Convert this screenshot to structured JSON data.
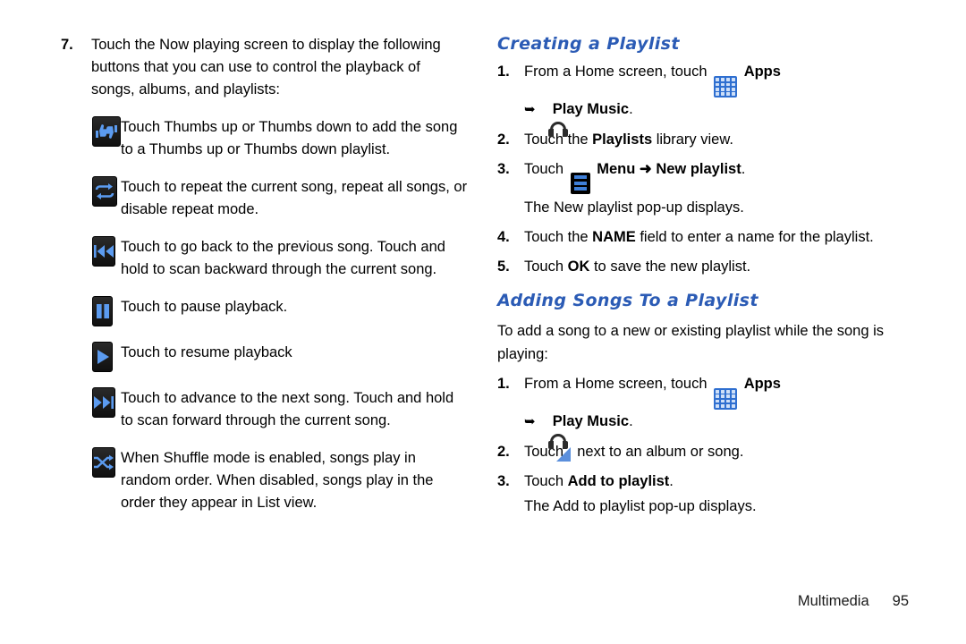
{
  "left_column": {
    "step": {
      "number": "7.",
      "text": "Touch the Now playing screen to display the following buttons that you can use to control the playback of songs, albums, and playlists:"
    },
    "controls": [
      {
        "icon": "thumbs-up-down-icon",
        "text": "Touch Thumbs up or Thumbs down to add the song to a Thumbs up or Thumbs down playlist."
      },
      {
        "icon": "repeat-icon",
        "text": "Touch to repeat the current song, repeat all songs, or disable repeat mode."
      },
      {
        "icon": "previous-track-icon",
        "text": "Touch to go back to the previous song. Touch and hold to scan backward through the current song."
      },
      {
        "icon": "pause-icon",
        "text": "Touch to pause playback."
      },
      {
        "icon": "play-icon",
        "text": "Touch to resume playback"
      },
      {
        "icon": "next-track-icon",
        "text": "Touch to advance to the next song. Touch and hold to scan forward through the current song."
      },
      {
        "icon": "shuffle-icon",
        "text": "When Shuffle mode is enabled, songs play in random order. When disabled, songs play in the order they appear in List view."
      }
    ]
  },
  "right_column": {
    "section1": {
      "title": "Creating a Playlist",
      "steps": [
        {
          "num": "1.",
          "pre": "From a Home screen, touch",
          "icon": "apps-grid-icon",
          "post": "Apps",
          "sub_icon": "play-music-icon",
          "sub_text": "Play Music",
          "sub_punct": "."
        },
        {
          "num": "2.",
          "pre": "Touch the",
          "bold": "Playlists",
          "post": "library view."
        },
        {
          "num": "3.",
          "pre": "Touch",
          "icon": "menu-list-icon",
          "bold1": "Menu",
          "arrow": "➜",
          "bold2": "New playlist",
          "post": ".",
          "note": "The New playlist pop-up displays."
        },
        {
          "num": "4.",
          "pre": "Touch the",
          "bold": "NAME",
          "post": "field to enter a name for the playlist."
        },
        {
          "num": "5.",
          "pre": "Touch",
          "bold": "OK",
          "post": "to save the new playlist."
        }
      ]
    },
    "section2": {
      "title": "Adding Songs To a Playlist",
      "intro": "To add a song to a new or existing playlist while the song is playing:",
      "steps": [
        {
          "num": "1.",
          "pre": "From a Home screen, touch",
          "icon": "apps-grid-icon",
          "post": "Apps",
          "sub_icon": "play-music-icon",
          "sub_text": "Play Music",
          "sub_punct": "."
        },
        {
          "num": "2.",
          "pre": "Touch",
          "icon": "context-corner-icon",
          "post": "next to an album or song."
        },
        {
          "num": "3.",
          "pre": "Touch",
          "bold": "Add to playlist",
          "post": ".",
          "note": "The Add to playlist pop-up displays."
        }
      ]
    }
  },
  "footer": {
    "chapter": "Multimedia",
    "page_number": "95"
  },
  "colors": {
    "heading": "#2b5bb5",
    "icon_blue": "#3f7fd8",
    "apps_blue": "#2f6fd0",
    "play_music_orange": "#f4a41c",
    "text": "#1a1a1a"
  }
}
